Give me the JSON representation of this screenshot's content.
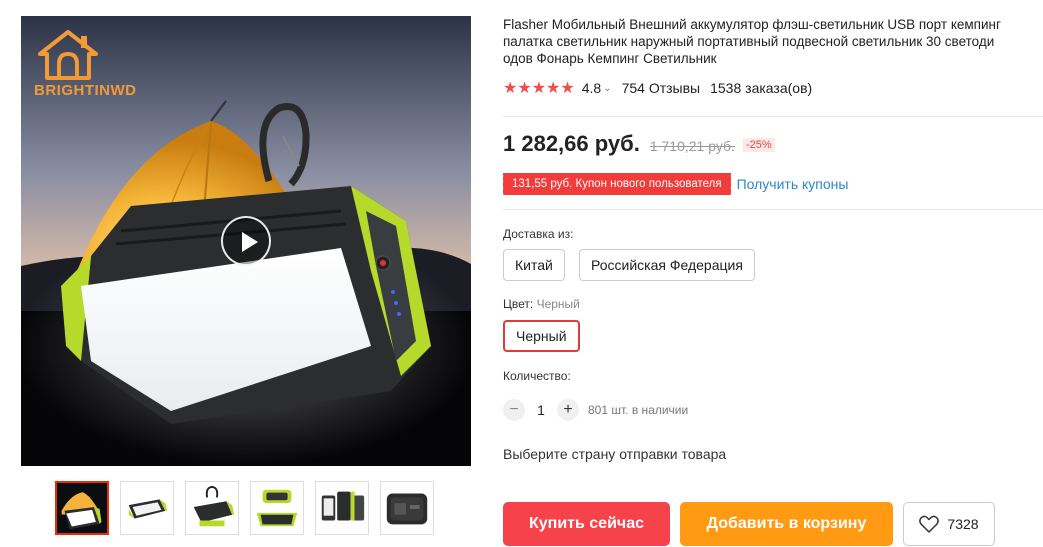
{
  "gallery": {
    "brand_name": "BRIGHTINWD",
    "thumbnail_count": 6
  },
  "product": {
    "title_lines": [
      "Flasher Мобильный Внешний аккумулятор флэш-светильник USB порт кемпинг",
      "палатка светильник наружный портативный подвесной светильник 30 светоди",
      "одов Фонарь Кемпинг Светильник"
    ],
    "stars": "★★★★★",
    "rating": "4.8",
    "reviews": "754 Отзывы",
    "orders": "1538 заказа(ов)",
    "price": "1 282,66 руб.",
    "old_price": "1 710,21 руб.",
    "discount": "-25%",
    "coupon_text": "131,55 руб. Купон нового пользователя",
    "get_coupons": "Получить купоны"
  },
  "shipping": {
    "label": "Доставка из:",
    "options": [
      "Китай",
      "Российская Федерация"
    ]
  },
  "color": {
    "label": "Цвет:",
    "selected_name": "Черный",
    "options": [
      "Черный"
    ]
  },
  "quantity": {
    "label": "Количество:",
    "minus": "−",
    "value": "1",
    "plus": "+",
    "stock": "801 шт. в наличии"
  },
  "ship_note": "Выберите страну отправки товара",
  "actions": {
    "buy_now": "Купить сейчас",
    "add_to_cart": "Добавить в корзину",
    "wishlist_count": "7328"
  },
  "colors": {
    "accent_red": "#f5424b",
    "cart_orange": "#ff9a12",
    "star_red": "#f44b4b",
    "link_blue": "#2d88c6",
    "brand_orange": "#f29a38"
  }
}
